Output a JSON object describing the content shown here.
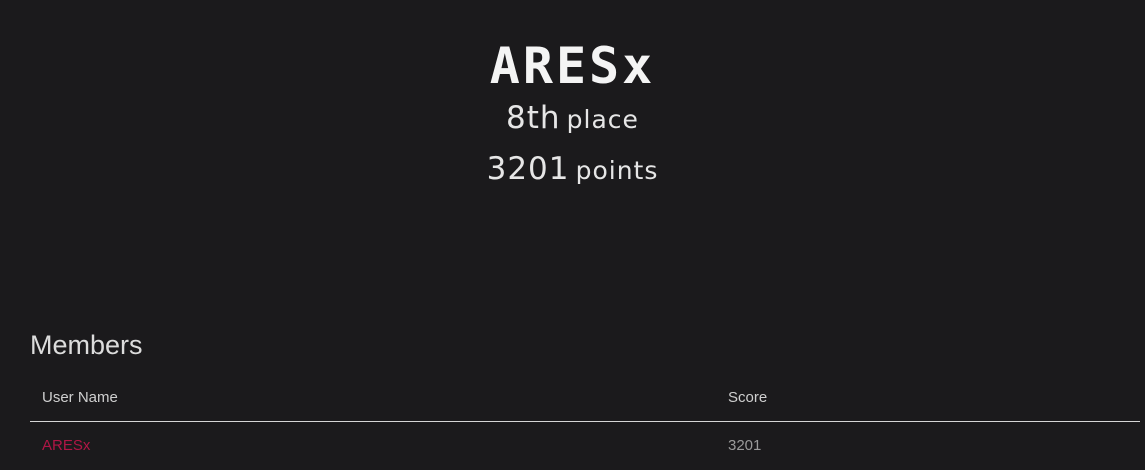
{
  "team": {
    "name": "ARESx",
    "place_value": "8th",
    "place_label": "place",
    "points_value": "3201",
    "points_label": "points"
  },
  "members": {
    "title": "Members",
    "columns": [
      "User Name",
      "Score"
    ],
    "rows": [
      {
        "user": "ARESx",
        "score": "3201"
      }
    ]
  },
  "colors": {
    "background": "#1b1a1c",
    "link": "#b01646",
    "text": "#e8e6e8"
  }
}
